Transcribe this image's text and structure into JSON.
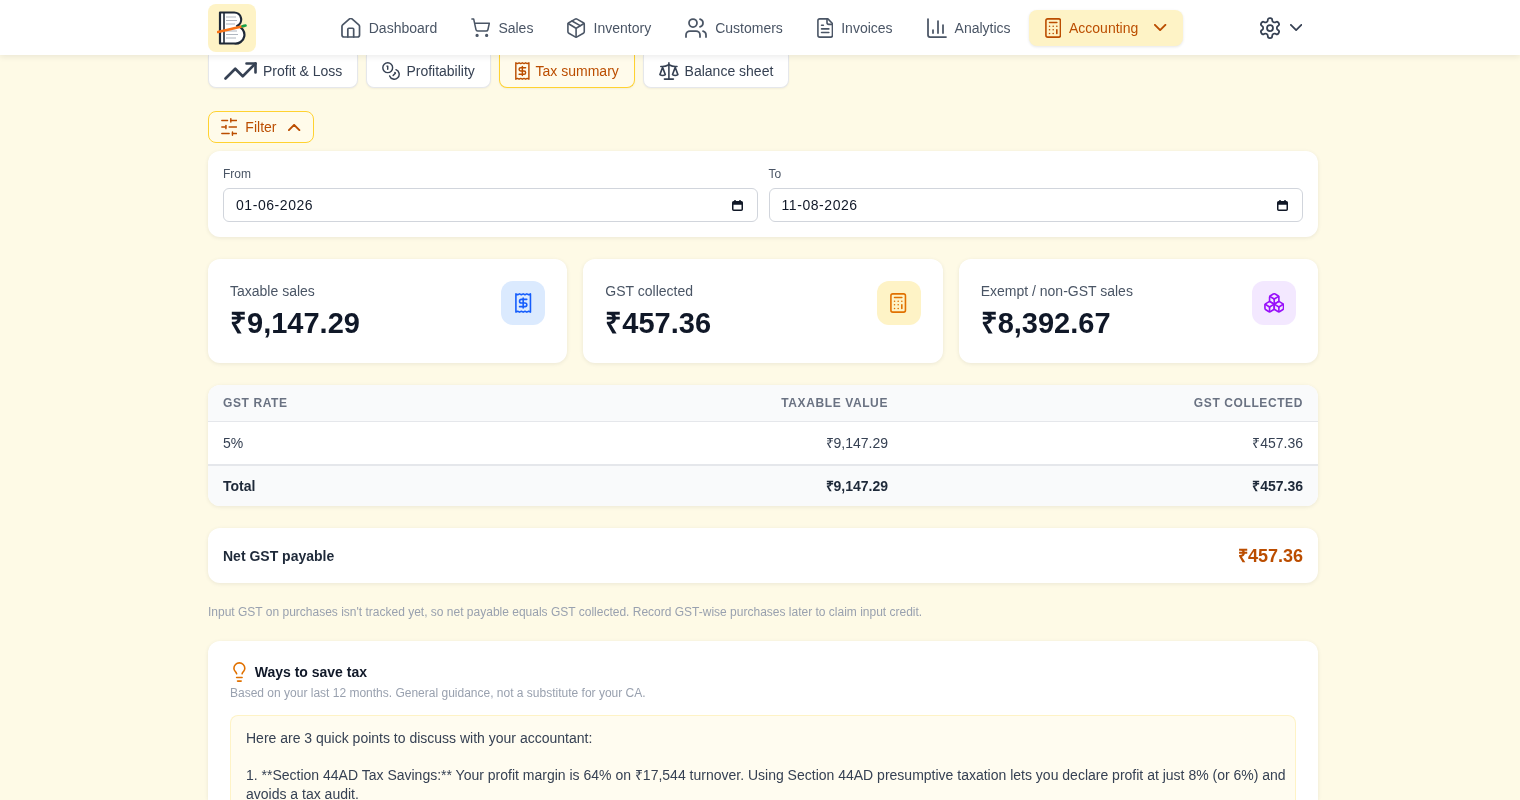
{
  "nav": {
    "items": [
      {
        "label": "Dashboard",
        "kind": "link",
        "selected": false
      },
      {
        "label": "Sales",
        "kind": "link",
        "selected": false
      },
      {
        "label": "Inventory",
        "kind": "link",
        "selected": false
      },
      {
        "label": "Customers",
        "kind": "link",
        "selected": false
      },
      {
        "label": "Invoices",
        "kind": "link",
        "selected": false
      },
      {
        "label": "Analytics",
        "kind": "link",
        "selected": false
      },
      {
        "label": "Accounting",
        "kind": "menu",
        "selected": true
      }
    ]
  },
  "subtabs": [
    {
      "label": "Profit & Loss",
      "selected": false
    },
    {
      "label": "Profitability",
      "selected": false
    },
    {
      "label": "Tax summary",
      "selected": true
    },
    {
      "label": "Balance sheet",
      "selected": false
    }
  ],
  "filter": {
    "label": "Filter",
    "expanded": true
  },
  "date_range": [
    {
      "label": "From",
      "value": "01-06-2026"
    },
    {
      "label": "To",
      "value": "11-08-2026"
    }
  ],
  "stats": [
    {
      "label": "Taxable sales",
      "value": "₹9,147.29"
    },
    {
      "label": "GST collected",
      "value": "₹457.36"
    },
    {
      "label": "Exempt / non-GST sales",
      "value": "₹8,392.67"
    }
  ],
  "table": {
    "columns": [
      "GST RATE",
      "TAXABLE VALUE",
      "GST COLLECTED"
    ],
    "rows": [
      {
        "kind": "data",
        "cells": [
          "5%",
          "₹9,147.29",
          "₹457.36"
        ]
      },
      {
        "kind": "total",
        "cells": [
          "Total",
          "₹9,147.29",
          "₹457.36"
        ]
      }
    ]
  },
  "net_payable": {
    "label": "Net GST payable",
    "value": "₹457.36"
  },
  "note": "Input GST on purchases isn't tracked yet, so net payable equals GST collected. Record GST-wise purchases later to claim input credit.",
  "tips": {
    "title": "Ways to save tax",
    "subtitle": "Based on your last 12 months. General guidance, not a substitute for your CA.",
    "paragraphs": [
      "Here are 3 quick points to discuss with your accountant:",
      "1. **Section 44AD Tax Savings:** Your profit margin is 64% on ₹17,544 turnover. Using Section 44AD presumptive taxation lets you declare profit at just 8% (or 6%) and avoids a tax audit."
    ]
  }
}
